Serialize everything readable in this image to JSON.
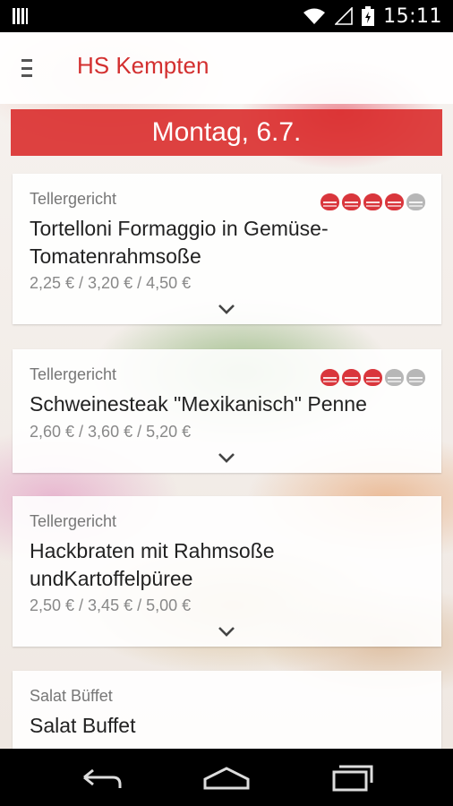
{
  "status_bar": {
    "time": "15:11",
    "icons": [
      "barcode-icon",
      "wifi-icon",
      "signal-icon",
      "battery-charging-icon"
    ]
  },
  "app_bar": {
    "menu_icon": "menu-icon",
    "title": "HS Kempten"
  },
  "date_banner": "Montag, 6.7.",
  "colors": {
    "accent": "#d32f2f",
    "banner": "#da2828",
    "rating_on": "#d9363c",
    "rating_off": "#b7b7b7"
  },
  "meals": [
    {
      "category": "Tellergericht",
      "name": "Tortelloni Formaggio in Gemüse-Tomatenrahmsoße",
      "prices": "2,25 € / 3,20 € / 4,50 €",
      "rating": 4,
      "rating_max": 5
    },
    {
      "category": "Tellergericht",
      "name": "Schweinesteak \"Mexikanisch\" Penne",
      "prices": "2,60 € / 3,60 € / 5,20 €",
      "rating": 3,
      "rating_max": 5
    },
    {
      "category": "Tellergericht",
      "name": "Hackbraten mit Rahmsoße undKartoffelpüree",
      "prices": "2,50 € / 3,45 € / 5,00 €",
      "rating": 0,
      "rating_max": 0
    },
    {
      "category": "Salat Büffet",
      "name": "Salat Buffet",
      "prices": "",
      "rating": 0,
      "rating_max": 0
    }
  ],
  "nav": {
    "back": "back-icon",
    "home": "home-icon",
    "recents": "recents-icon"
  }
}
